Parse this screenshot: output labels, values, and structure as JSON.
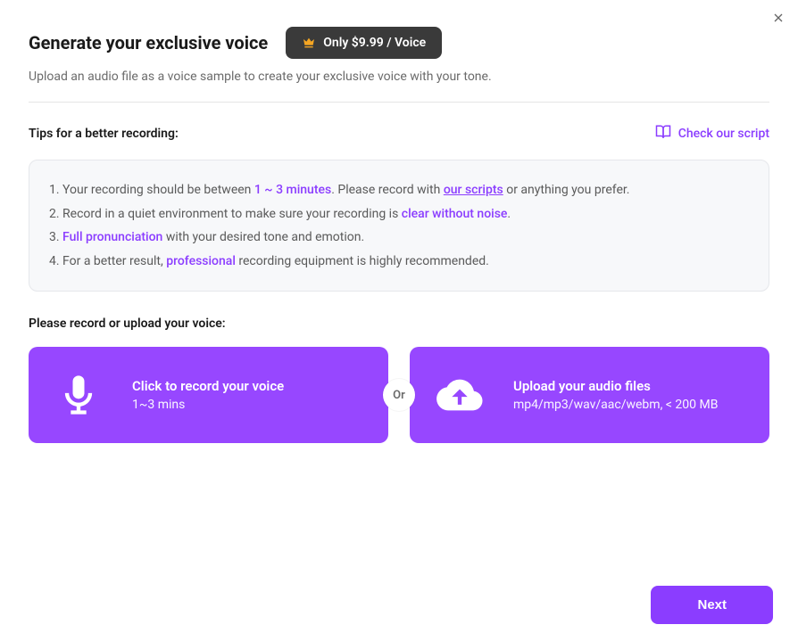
{
  "header": {
    "title": "Generate your exclusive voice",
    "priceBadge": "Only $9.99 / Voice",
    "subtitle": "Upload an audio file as a voice sample to create your exclusive voice with your tone."
  },
  "tips": {
    "title": "Tips for a better recording:",
    "checkScript": "Check our script",
    "items": {
      "t1a": "Your recording should be between ",
      "t1b": "1 ~ 3 minutes",
      "t1c": ". Please record with ",
      "t1d": "our scripts",
      "t1e": " or anything you prefer.",
      "t2a": "Record in a quiet environment to make sure your recording is ",
      "t2b": "clear without noise",
      "t2c": ".",
      "t3a": "Full pronunciation",
      "t3b": " with your desired tone and emotion.",
      "t4a": "For a better result, ",
      "t4b": "professional",
      "t4c": " recording equipment is highly recommended."
    }
  },
  "recordPrompt": "Please record or upload your voice:",
  "options": {
    "or": "Or",
    "record": {
      "title": "Click to record your voice",
      "sub": "1~3 mins"
    },
    "upload": {
      "title": "Upload your audio files",
      "sub": "mp4/mp3/wav/aac/webm, < 200 MB"
    }
  },
  "next": "Next"
}
